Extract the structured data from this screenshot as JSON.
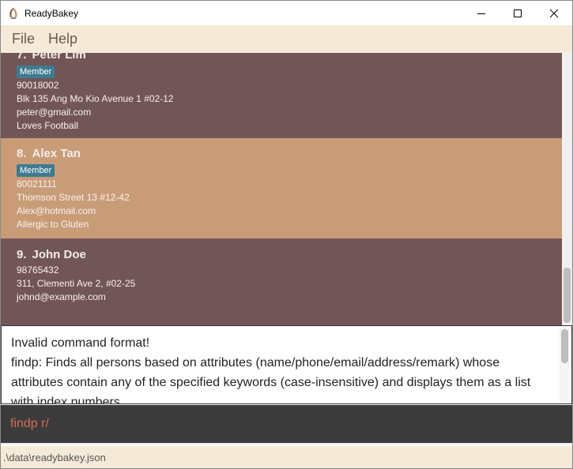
{
  "window": {
    "title": "ReadyBakey",
    "icon": "readybakey-logo-icon"
  },
  "menu": {
    "items": [
      {
        "label": "File"
      },
      {
        "label": "Help"
      }
    ]
  },
  "persons": [
    {
      "index": "7.",
      "name": "Peter Lim",
      "tag": "Member",
      "phone": "90018002",
      "address": "Blk 135 Ang Mo Kio Avenue 1 #02-12",
      "email": "peter@gmail.com",
      "remark": "Loves Football"
    },
    {
      "index": "8.",
      "name": "Alex Tan",
      "tag": "Member",
      "phone": "80021111",
      "address": "Thomson Street 13 #12-42",
      "email": "Alex@hotmail.com",
      "remark": "Allergic to Gluten"
    },
    {
      "index": "9.",
      "name": "John Doe",
      "tag": "",
      "phone": "98765432",
      "address": "311, Clementi Ave 2, #02-25",
      "email": "johnd@example.com",
      "remark": ""
    }
  ],
  "result": {
    "text": "Invalid command format!\nfindp: Finds all persons based on attributes (name/phone/email/address/remark) whose attributes contain any of the specified keywords (case-insensitive) and displays them as a list with index numbers."
  },
  "command": {
    "value": "findp r/"
  },
  "status": {
    "path": ".\\data\\readybakey.json"
  },
  "colors": {
    "menu_bg": "#f5ead7",
    "card_dark": "#725556",
    "card_selected": "#c99c78",
    "tag_bg": "#3e7b91",
    "command_bg": "#3b3b3b",
    "command_text": "#d36d54"
  }
}
